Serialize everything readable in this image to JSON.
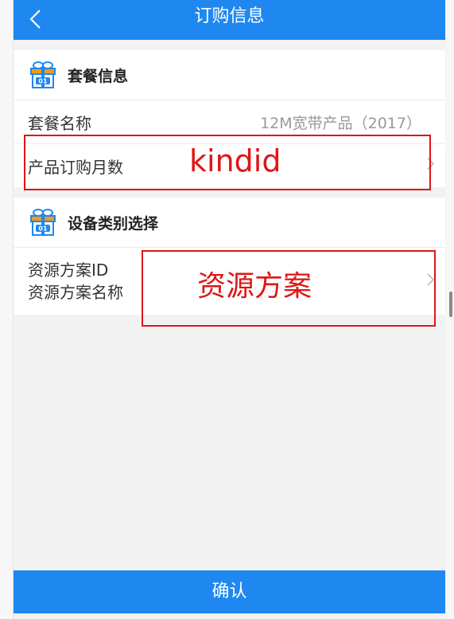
{
  "header": {
    "title": "订购信息",
    "back_icon": "chevron-left-icon"
  },
  "section_package": {
    "title": "套餐信息",
    "icon": "package-icon",
    "rows": [
      {
        "label": "套餐名称",
        "value": "12M宽带产品（2017）"
      },
      {
        "label": "产品订购月数",
        "value": ""
      }
    ]
  },
  "section_device": {
    "title": "设备类别选择",
    "icon": "package-icon",
    "row_labels": [
      "资源方案ID",
      "资源方案名称"
    ]
  },
  "annotations": {
    "box1_text": "kindid",
    "box2_text": "资源方案",
    "color": "#e01515"
  },
  "footer": {
    "confirm_label": "确认"
  },
  "colors": {
    "primary": "#1e88f0",
    "background": "#f2f2f2"
  }
}
